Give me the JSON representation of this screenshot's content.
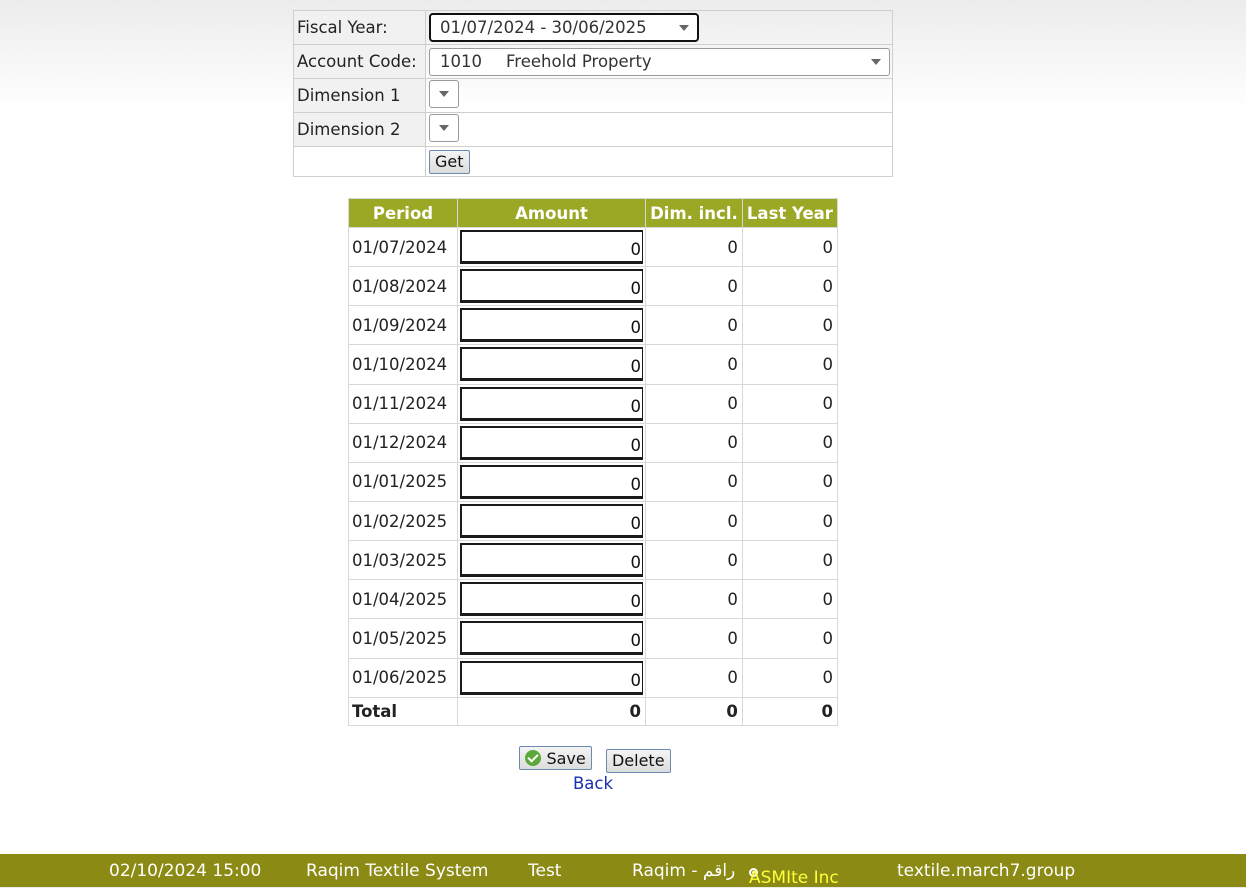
{
  "filter": {
    "fiscal_year_label": "Fiscal Year:",
    "fiscal_year_value": "01/07/2024 - 30/06/2025",
    "account_code_label": "Account Code:",
    "account_code": "1010",
    "account_name": "Freehold Property",
    "dimension1_label": "Dimension 1",
    "dimension2_label": "Dimension 2",
    "get_label": "Get"
  },
  "table": {
    "headers": [
      "Period",
      "Amount",
      "Dim. incl.",
      "Last Year"
    ],
    "rows": [
      {
        "period": "01/07/2024",
        "amount": "0",
        "dim": "0",
        "last_year": "0"
      },
      {
        "period": "01/08/2024",
        "amount": "0",
        "dim": "0",
        "last_year": "0"
      },
      {
        "period": "01/09/2024",
        "amount": "0",
        "dim": "0",
        "last_year": "0"
      },
      {
        "period": "01/10/2024",
        "amount": "0",
        "dim": "0",
        "last_year": "0"
      },
      {
        "period": "01/11/2024",
        "amount": "0",
        "dim": "0",
        "last_year": "0"
      },
      {
        "period": "01/12/2024",
        "amount": "0",
        "dim": "0",
        "last_year": "0"
      },
      {
        "period": "01/01/2025",
        "amount": "0",
        "dim": "0",
        "last_year": "0"
      },
      {
        "period": "01/02/2025",
        "amount": "0",
        "dim": "0",
        "last_year": "0"
      },
      {
        "period": "01/03/2025",
        "amount": "0",
        "dim": "0",
        "last_year": "0"
      },
      {
        "period": "01/04/2025",
        "amount": "0",
        "dim": "0",
        "last_year": "0"
      },
      {
        "period": "01/05/2025",
        "amount": "0",
        "dim": "0",
        "last_year": "0"
      },
      {
        "period": "01/06/2025",
        "amount": "0",
        "dim": "0",
        "last_year": "0"
      }
    ],
    "total_label": "Total",
    "total_amount": "0",
    "total_dim": "0",
    "total_last_year": "0"
  },
  "actions": {
    "save_label": "Save",
    "delete_label": "Delete",
    "back_label": "Back"
  },
  "footer": {
    "datetime": "02/10/2024 15:00",
    "app_name": "Raqim Textile System",
    "mode": "Test",
    "brand": "Raqim - راقم",
    "company": "ASMIte Inc",
    "host": "textile.march7.group"
  },
  "colors": {
    "header_bg": "#9ba826",
    "footer_bg": "#8a8a14",
    "company_text": "#ffff3a",
    "link": "#1b2fb0"
  }
}
